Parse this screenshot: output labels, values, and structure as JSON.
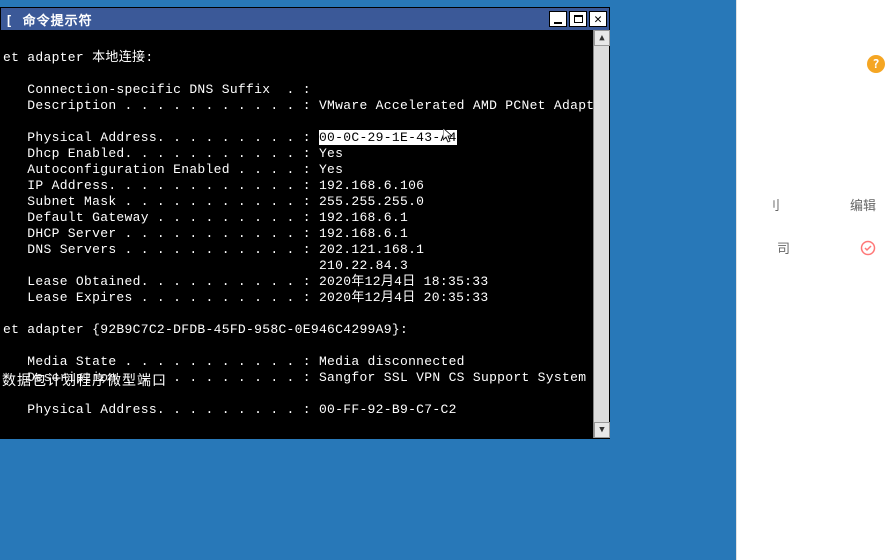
{
  "window": {
    "title": "命令提示符",
    "title_prefix": "[ "
  },
  "terminal": {
    "adapter1_label": "et adapter 本地连接:",
    "l1": "   Connection-specific DNS Suffix  . :",
    "l2": "   Description . . . . . . . . . . . : VMware Accelerated AMD PCNet Adapter",
    "l3a": "   Physical Address. . . . . . . . . : ",
    "l3b": "00-0C-29-1E-43-A4",
    "l4": "   Dhcp Enabled. . . . . . . . . . . : Yes",
    "l5": "   Autoconfiguration Enabled . . . . : Yes",
    "l6": "   IP Address. . . . . . . . . . . . : 192.168.6.106",
    "l7": "   Subnet Mask . . . . . . . . . . . : 255.255.255.0",
    "l8": "   Default Gateway . . . . . . . . . : 192.168.6.1",
    "l9": "   DHCP Server . . . . . . . . . . . : 192.168.6.1",
    "l10": "   DNS Servers . . . . . . . . . . . : 202.121.168.1",
    "l10b": "                                       210.22.84.3",
    "l11": "   Lease Obtained. . . . . . . . . . : 2020年12月4日 18:35:33",
    "l12": "   Lease Expires . . . . . . . . . . : 2020年12月4日 20:35:33",
    "adapter2_label": "et adapter {92B9C7C2-DFDB-45FD-958C-0E946C4299A9}:",
    "l13": "   Media State . . . . . . . . . . . : Media disconnected",
    "l14": "   Description . . . . . . . . . . . : Sangfor SSL VPN CS Support System VN",
    "l15": "   Physical Address. . . . . . . . . : 00-FF-92-B9-C7-C2"
  },
  "caption": "数据包计划程序微型端口",
  "side": {
    "row1_partial": "刂",
    "row1_action": "编辑",
    "row2_partial": "司"
  }
}
